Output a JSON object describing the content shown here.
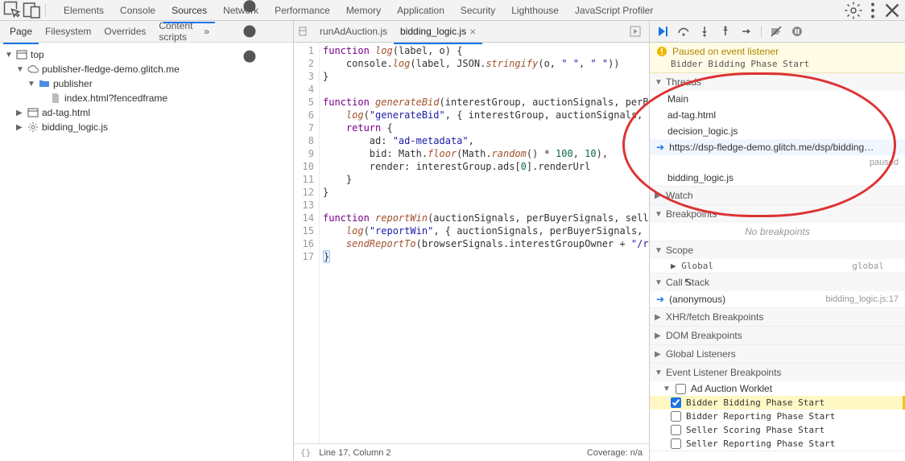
{
  "topTabs": [
    "Elements",
    "Console",
    "Sources",
    "Network",
    "Performance",
    "Memory",
    "Application",
    "Security",
    "Lighthouse",
    "JavaScript Profiler"
  ],
  "leftSubTabs": [
    "Page",
    "Filesystem",
    "Overrides",
    "Content scripts"
  ],
  "tree": {
    "top": "top",
    "origin": "publisher-fledge-demo.glitch.me",
    "folder": "publisher",
    "file_index": "index.html?fencedframe",
    "adtag": "ad-tag.html",
    "bidlogic": "bidding_logic.js"
  },
  "editor": {
    "tabs": [
      "runAdAuction.js",
      "bidding_logic.js"
    ],
    "status": {
      "cursor": "Line 17, Column 2",
      "coverage": "Coverage: n/a"
    }
  },
  "pauseBanner": {
    "title": "Paused on event listener",
    "subtitle": "Bidder Bidding Phase Start"
  },
  "threads": {
    "title": "Threads",
    "items": [
      "Main",
      "ad-tag.html",
      "decision_logic.js",
      "https://dsp-fledge-demo.glitch.me/dsp/bidding_lo…",
      "bidding_logic.js"
    ],
    "pausedLabel": "paused"
  },
  "sections": {
    "watch": "Watch",
    "breakpoints": "Breakpoints",
    "scope": "Scope",
    "callstack": "Call Stack",
    "xhr": "XHR/fetch Breakpoints",
    "dom": "DOM Breakpoints",
    "global": "Global Listeners",
    "evlb": "Event Listener Breakpoints"
  },
  "breakpoints": {
    "empty": "No breakpoints"
  },
  "scope": {
    "label": "Global",
    "value": "global"
  },
  "callstack": {
    "frame": "(anonymous)",
    "source": "bidding_logic.js:17"
  },
  "eventListener": {
    "category": "Ad Auction Worklet",
    "items": [
      "Bidder Bidding Phase Start",
      "Bidder Reporting Phase Start",
      "Seller Scoring Phase Start",
      "Seller Reporting Phase Start"
    ]
  }
}
